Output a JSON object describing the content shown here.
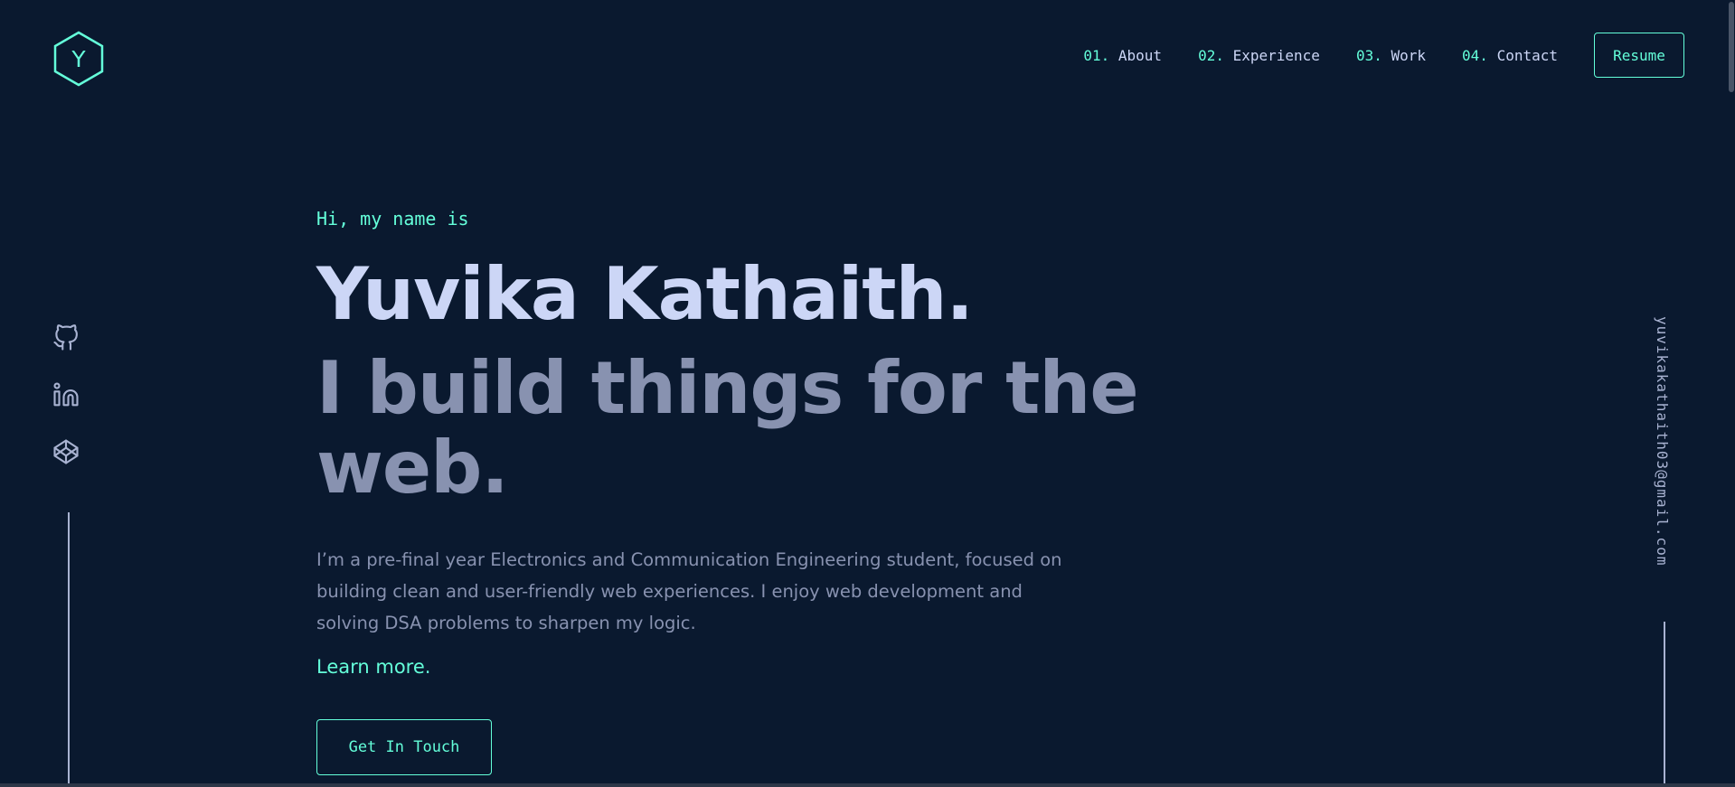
{
  "header": {
    "logo_letter": "Y",
    "nav": [
      {
        "num": "01.",
        "label": "About"
      },
      {
        "num": "02.",
        "label": "Experience"
      },
      {
        "num": "03.",
        "label": "Work"
      },
      {
        "num": "04.",
        "label": "Contact"
      }
    ],
    "resume_label": "Resume"
  },
  "hero": {
    "intro": "Hi, my name is",
    "name": "Yuvika Kathaith.",
    "tagline": "I build things for the web.",
    "bio": "I’m a pre-final year Electronics and Communication Engineering student, focused on building clean and user-friendly web experiences. I enjoy web development and solving DSA problems to sharpen my logic.",
    "learn_more": "Learn more.",
    "cta_label": "Get In Touch"
  },
  "social": {
    "icons": [
      "github-icon",
      "linkedin-icon",
      "codepen-icon"
    ]
  },
  "email": "yuvikakathaith03@gmail.com",
  "colors": {
    "background": "#0a192f",
    "accent": "#64ffda",
    "heading": "#ccd6f6",
    "text": "#8892b0",
    "sidebar": "#a8b2d1"
  }
}
